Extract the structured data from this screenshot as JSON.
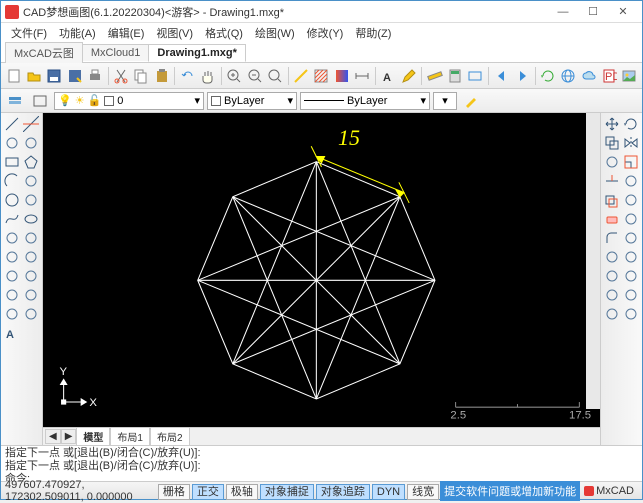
{
  "window": {
    "title": "CAD梦想画图(6.1.20220304)<游客> - Drawing1.mxg*",
    "controls": {
      "min": "—",
      "max": "☐",
      "close": "✕"
    }
  },
  "menu": [
    "文件(F)",
    "功能(A)",
    "编辑(E)",
    "视图(V)",
    "格式(Q)",
    "绘图(W)",
    "修改(Y)",
    "帮助(Z)"
  ],
  "tabs": {
    "items": [
      {
        "label": "MxCAD云图",
        "active": false
      },
      {
        "label": "MxCloud1",
        "active": false
      },
      {
        "label": "Drawing1.mxg*",
        "active": true
      }
    ]
  },
  "toolbar_icons": [
    "new",
    "open",
    "save",
    "saveas",
    "print",
    "|",
    "cut",
    "copy",
    "paste",
    "|",
    "undo",
    "hand",
    "|",
    "zoom-in",
    "zoom-out",
    "zoom-ext",
    "|",
    "line-y",
    "hatch",
    "gradient",
    "dim",
    "|",
    "text",
    "pencil",
    "|",
    "measure",
    "calc",
    "rect",
    "|",
    "back",
    "forward",
    "|",
    "refresh",
    "globe",
    "cloud",
    "pdf",
    "image"
  ],
  "layer": {
    "layer_name": "0",
    "color_sel_label": "ByLayer",
    "linetype_label": "ByLayer"
  },
  "left_tools": [
    "line",
    "xline",
    "pline",
    "polyline",
    "rect",
    "polygon",
    "arc",
    "donut",
    "circle",
    "revcloud",
    "spline",
    "ellipse",
    "ellipse-arc",
    "point",
    "hatch",
    "block",
    "region",
    "table",
    "mtext",
    "helix",
    "dimension",
    "multileader",
    "text-a"
  ],
  "right_tools": [
    "move",
    "rotate",
    "copy",
    "mirror",
    "stretch",
    "scale",
    "trim",
    "extend",
    "offset",
    "array",
    "erase",
    "explode",
    "fillet",
    "chamfer",
    "break",
    "join",
    "align",
    "lengthen",
    "edit-pline",
    "edit-hatch",
    "match-prop",
    "properties"
  ],
  "drawing": {
    "dimension_value": "15",
    "scale_left": "2.5",
    "scale_right": "17.5",
    "ucs_x": "X",
    "ucs_y": "Y"
  },
  "canvas_tabs": {
    "nav_prev": "◀",
    "nav_next": "▶",
    "items": [
      "模型",
      "布局1",
      "布局2"
    ]
  },
  "command": {
    "line1": "指定下一点 或[退出(B)/闭合(C)/放弃(U)]:",
    "line2": "指定下一点 或[退出(B)/闭合(C)/放弃(U)]:",
    "prompt": "命令:"
  },
  "status": {
    "coords": "497607.470927, 172302.509011, 0.000000",
    "buttons": [
      {
        "label": "栅格",
        "active": false
      },
      {
        "label": "正交",
        "active": true
      },
      {
        "label": "极轴",
        "active": false
      },
      {
        "label": "对象捕捉",
        "active": true
      },
      {
        "label": "对象追踪",
        "active": true
      },
      {
        "label": "DYN",
        "active": true
      },
      {
        "label": "线宽",
        "active": false
      }
    ],
    "help": "提交软件问题或增加新功能",
    "brand": "MxCAD"
  },
  "colors": {
    "accent": "#3b8ed8",
    "canvas_bg": "#000000",
    "dim": "#ffff00",
    "drawing": "#ffffff"
  }
}
